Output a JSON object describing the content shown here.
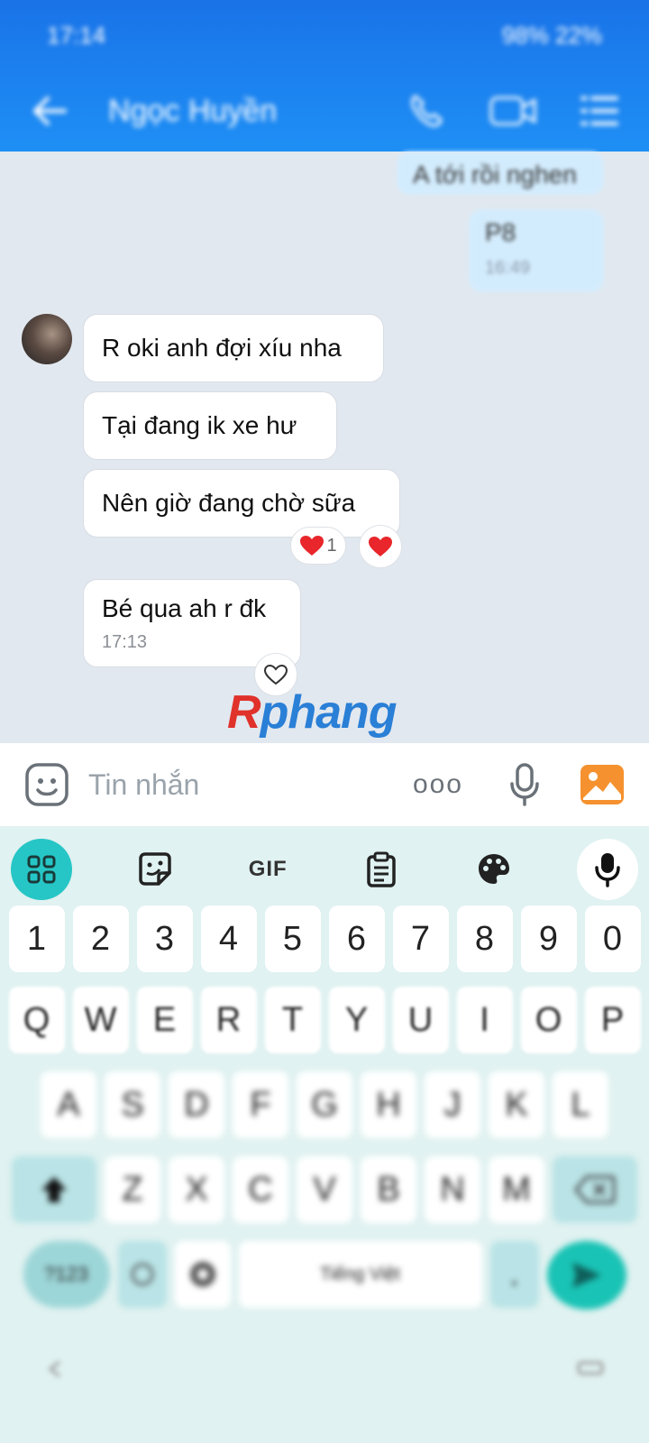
{
  "status_bar": {
    "time": "17:14",
    "right_text": "98% 22%"
  },
  "header": {
    "contact_name": "Ngọc Huyền"
  },
  "chat": {
    "outgoing": [
      {
        "text": "A tới rồi nghen"
      },
      {
        "text": "P8",
        "time": "16:49"
      }
    ],
    "incoming": [
      {
        "text": "R oki anh đợi xíu nha"
      },
      {
        "text": "Tại đang ik xe hư"
      },
      {
        "text": "Nên giờ đang chờ sữa",
        "reaction_count": "1"
      },
      {
        "text": "Bé qua ah r đk",
        "time": "17:13"
      }
    ],
    "reaction_colors": {
      "heart": "#e8262b"
    }
  },
  "watermark": {
    "first": "R",
    "rest": "phang"
  },
  "input": {
    "placeholder": "Tin nhắn",
    "more": "ooo"
  },
  "keyboard": {
    "toolbar": {
      "gif": "GIF"
    },
    "numbers": [
      "1",
      "2",
      "3",
      "4",
      "5",
      "6",
      "7",
      "8",
      "9",
      "0"
    ],
    "row1": [
      "Q",
      "W",
      "E",
      "R",
      "T",
      "Y",
      "U",
      "I",
      "O",
      "P"
    ],
    "row2": [
      "A",
      "S",
      "D",
      "F",
      "G",
      "H",
      "J",
      "K",
      "L"
    ],
    "row3": [
      "Z",
      "X",
      "C",
      "V",
      "B",
      "N",
      "M"
    ],
    "sym_label": "?123",
    "space_label": "Tiếng Việt",
    "period": "."
  },
  "colors": {
    "header": "#1a73e8",
    "toolbar_active": "#26c6c6",
    "send": "#19c3b5"
  }
}
